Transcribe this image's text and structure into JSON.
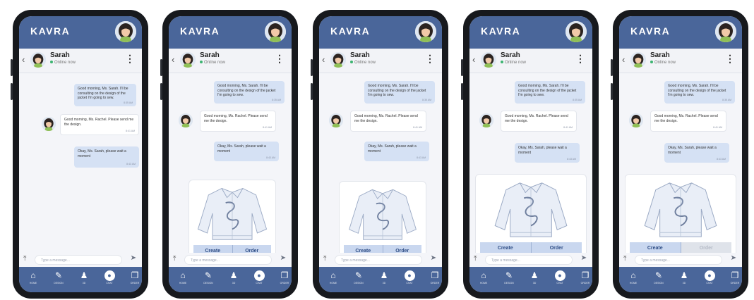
{
  "app": {
    "brand": "KAVRA",
    "contact_name": "Sarah",
    "contact_status": "Online now",
    "back_icon": "chevron-left-icon",
    "more_icon": "more-vertical-icon"
  },
  "messages": {
    "m1": {
      "text": "Good morning, Ms. Sarah. I'll be consulting on the design of the jacket I'm going to sew.",
      "time": "8:35 AM"
    },
    "m2": {
      "text": "Good morning, Ms. Rachel. Please send me the design.",
      "time": "8:41 AM"
    },
    "m3": {
      "text": "Okay, Ms. Sarah, please wait a moment",
      "time": "8:43 AM"
    }
  },
  "design_card": {
    "create_label": "Create",
    "order_label": "Order"
  },
  "composer": {
    "placeholder": "Type a message...",
    "attach_icon": "upload-icon",
    "send_icon": "send-icon"
  },
  "nav": [
    {
      "label": "HOME",
      "icon": "home-icon"
    },
    {
      "label": "DESIGN",
      "icon": "pencil-icon"
    },
    {
      "label": "3D",
      "icon": "people-icon"
    },
    {
      "label": "CHAT",
      "icon": "chat-icon"
    },
    {
      "label": "ORDER",
      "icon": "copy-icon"
    }
  ],
  "colors": {
    "brand": "#4a669a",
    "outgoing_bubble": "#d5e1f4",
    "button": "#c9d7ef",
    "online": "#3cb371"
  }
}
